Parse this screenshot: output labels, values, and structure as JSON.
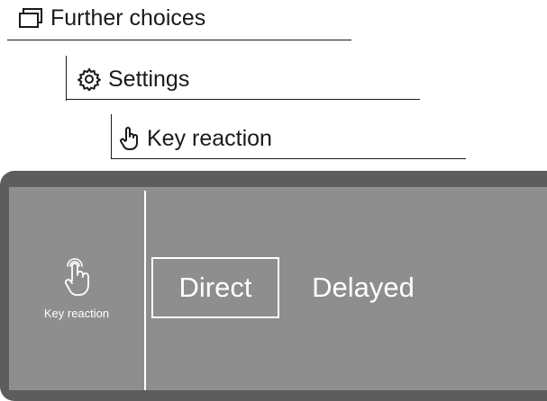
{
  "breadcrumbs": [
    {
      "label": "Further choices",
      "icon": "window-stack-icon"
    },
    {
      "label": "Settings",
      "icon": "gear-icon"
    },
    {
      "label": "Key reaction",
      "icon": "hand-pointer-icon"
    }
  ],
  "panel": {
    "side_icon": "hand-pointer-icon",
    "side_label": "Key reaction",
    "options": [
      {
        "label": "Direct",
        "selected": true
      },
      {
        "label": "Delayed",
        "selected": false
      }
    ]
  },
  "colors": {
    "panel_frame": "#5d5d5d",
    "screen_background": "#8e8e8e",
    "screen_text": "#ffffff"
  }
}
